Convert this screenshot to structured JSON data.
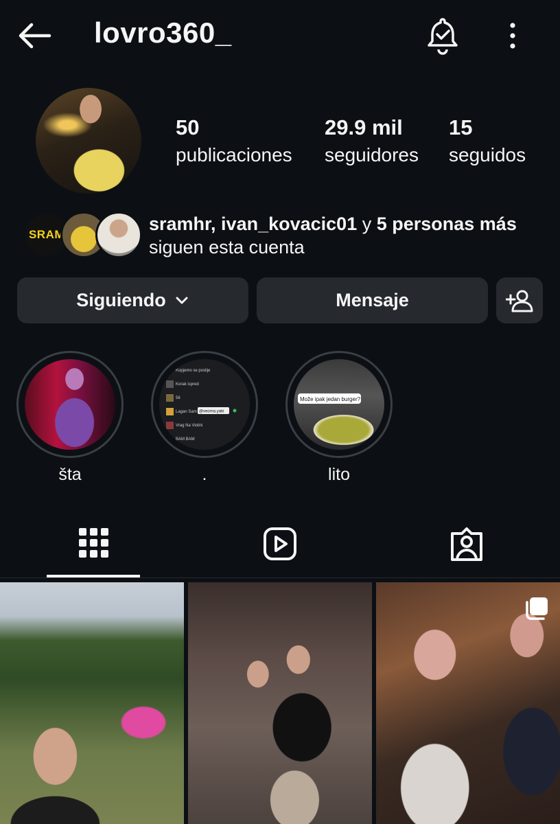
{
  "header": {
    "username": "lovro360_"
  },
  "profile": {
    "stats": [
      {
        "value": "50",
        "label": "publicaciones"
      },
      {
        "value": "29.9 mil",
        "label": "seguidores"
      },
      {
        "value": "15",
        "label": "seguidos"
      }
    ],
    "mutual": {
      "names": "sramhr, ivan_kovacic01",
      "connector": " y ",
      "others": "5 personas más",
      "suffix": "siguen esta cuenta",
      "first_avatar_text": "SRAM"
    }
  },
  "actions": {
    "following_label": "Siguiendo",
    "message_label": "Mensaje"
  },
  "highlights": [
    {
      "label": "šta"
    },
    {
      "label": "."
    },
    {
      "label": "lito"
    }
  ],
  "highlight_overlays": {
    "playlist_rows": [
      "Kopjemo se poslije",
      "Korak ispred",
      "56",
      "Lagan Sam",
      "Vrag Na Violini",
      "BAM BAM"
    ],
    "mention": "@veoma.yaki",
    "burger_caption": "Može ipak jedan burger?"
  },
  "colors": {
    "background": "#0c1014",
    "button": "#262a2f",
    "text": "#f5f5f5"
  },
  "icons": {
    "back": "arrow-left-icon",
    "notifications": "bell-check-icon",
    "more": "more-vertical-icon",
    "add_person": "add-person-icon",
    "grid": "grid-icon",
    "reels": "reels-icon",
    "tagged": "tagged-icon",
    "multi": "carousel-icon"
  }
}
